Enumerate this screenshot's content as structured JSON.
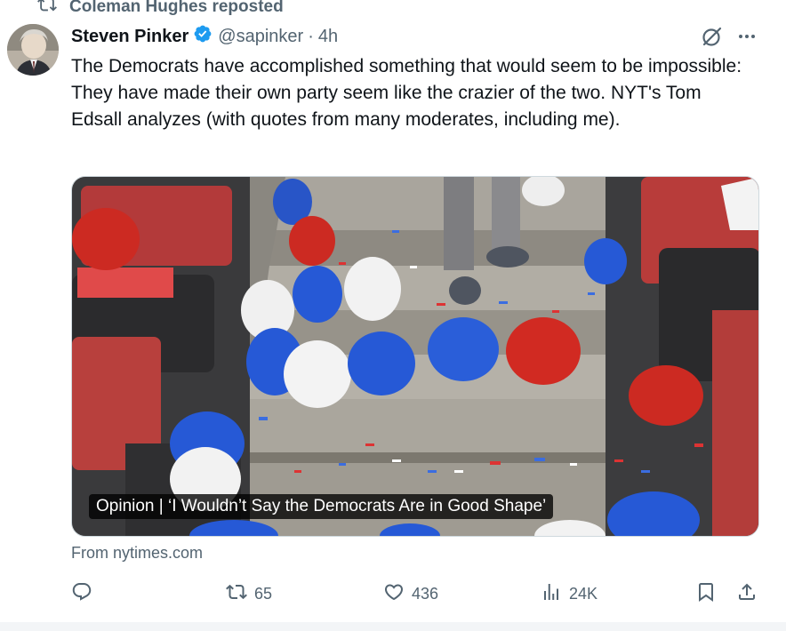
{
  "repost": {
    "label": "Coleman Hughes reposted"
  },
  "post": {
    "author_name": "Steven Pinker",
    "handle": "@sapinker",
    "separator": "·",
    "time": "4h",
    "text": "The Democrats have accomplished something that would seem to be impossible: They have made their own party seem like the crazier of the two. NYT's Tom Edsall analyzes (with quotes from many moderates, including me).",
    "link_card": {
      "headline": "Opinion | ‘I Wouldn’t Say the Democrats Are in Good Shape’",
      "source": "From nytimes.com"
    }
  },
  "actions": {
    "replies": "",
    "reposts": "65",
    "likes": "436",
    "views": "24K"
  },
  "icons": {
    "repost": "repost-icon",
    "verified": "verified-badge-icon",
    "grok": "grok-icon",
    "more": "more-icon",
    "reply": "reply-icon",
    "like": "heart-icon",
    "views": "views-icon",
    "bookmark": "bookmark-icon",
    "share": "share-icon"
  },
  "colors": {
    "verified_blue": "#1d9bf0",
    "muted_text": "#536471",
    "primary_text": "#0f1419"
  }
}
